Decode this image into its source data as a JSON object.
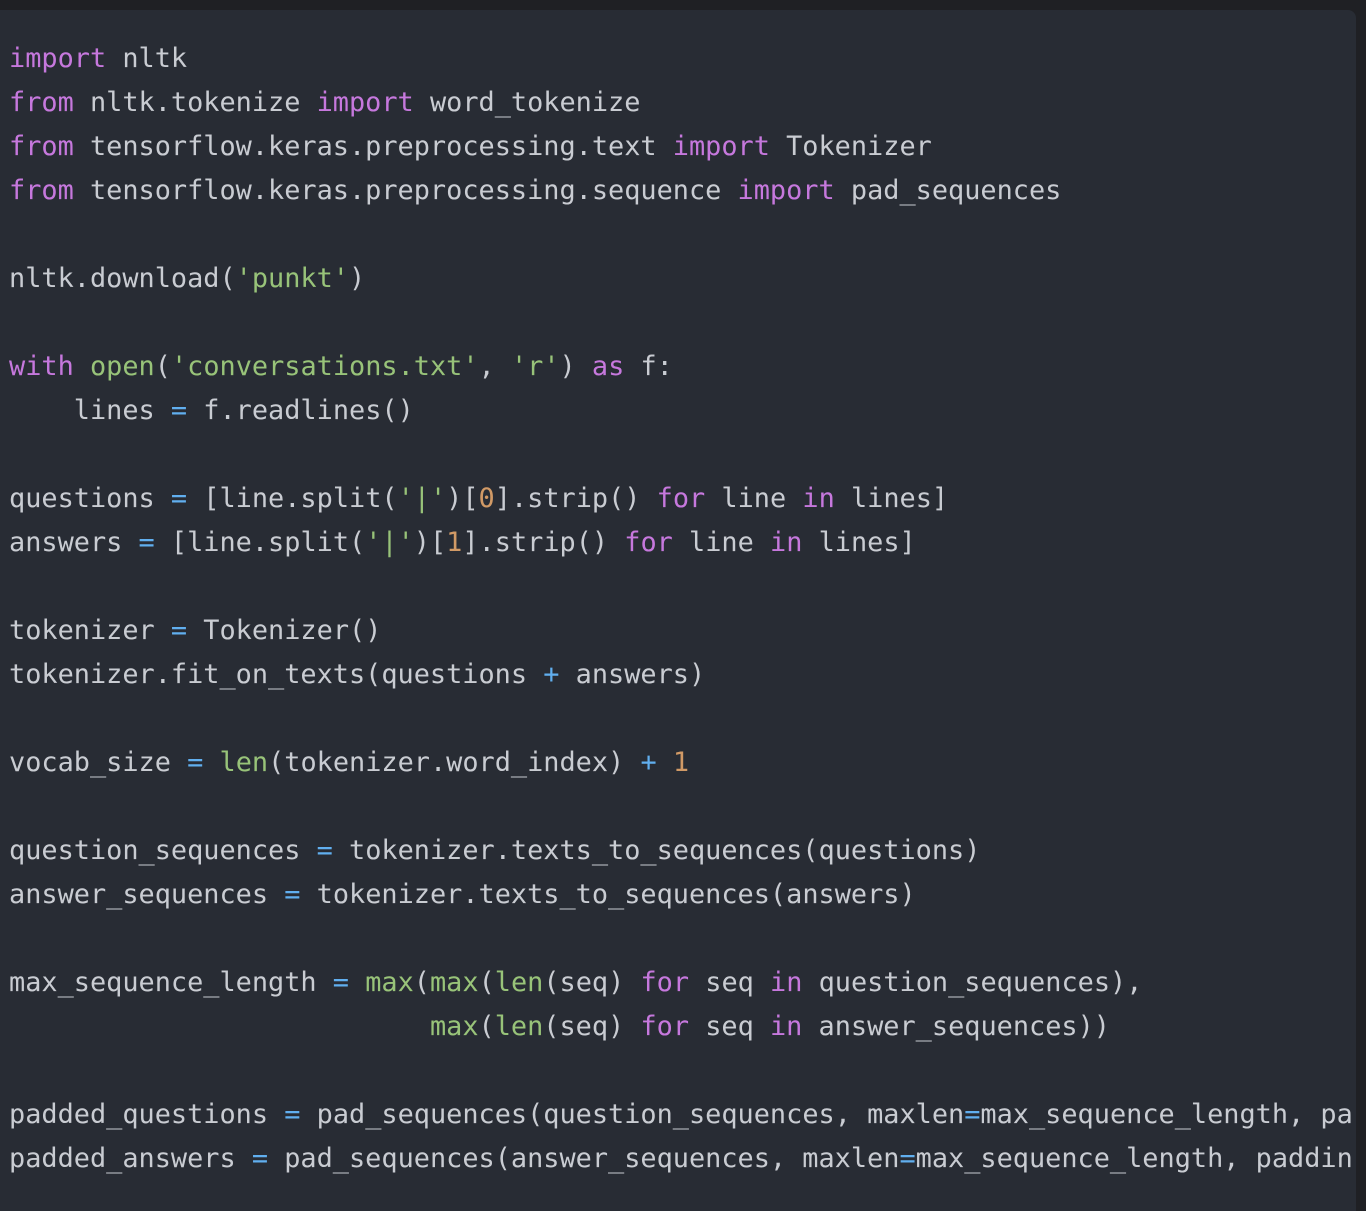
{
  "colors": {
    "background": "#282c34",
    "outer": "#1f2024",
    "plain": "#c9ccd2",
    "keyword": "#c678dd",
    "string": "#98c379",
    "number": "#d19a66",
    "operator": "#61afef",
    "builtin": "#98c379"
  },
  "code": {
    "language": "python",
    "lines": [
      [
        [
          "kw",
          "import"
        ],
        [
          "p",
          " nltk"
        ]
      ],
      [
        [
          "kw",
          "from"
        ],
        [
          "p",
          " nltk.tokenize "
        ],
        [
          "kw",
          "import"
        ],
        [
          "p",
          " word_tokenize"
        ]
      ],
      [
        [
          "kw",
          "from"
        ],
        [
          "p",
          " tensorflow.keras.preprocessing.text "
        ],
        [
          "kw",
          "import"
        ],
        [
          "p",
          " Tokenizer"
        ]
      ],
      [
        [
          "kw",
          "from"
        ],
        [
          "p",
          " tensorflow.keras.preprocessing.sequence "
        ],
        [
          "kw",
          "import"
        ],
        [
          "p",
          " pad_sequences"
        ]
      ],
      [],
      [
        [
          "p",
          "nltk.download("
        ],
        [
          "str",
          "'punkt'"
        ],
        [
          "p",
          ")"
        ]
      ],
      [],
      [
        [
          "kw",
          "with"
        ],
        [
          "p",
          " "
        ],
        [
          "bi",
          "open"
        ],
        [
          "p",
          "("
        ],
        [
          "str",
          "'conversations.txt'"
        ],
        [
          "p",
          ", "
        ],
        [
          "str",
          "'r'"
        ],
        [
          "p",
          ") "
        ],
        [
          "kw",
          "as"
        ],
        [
          "p",
          " f:"
        ]
      ],
      [
        [
          "p",
          "    lines "
        ],
        [
          "op",
          "="
        ],
        [
          "p",
          " f.readlines()"
        ]
      ],
      [],
      [
        [
          "p",
          "questions "
        ],
        [
          "op",
          "="
        ],
        [
          "p",
          " [line.split("
        ],
        [
          "str",
          "'|'"
        ],
        [
          "p",
          ")["
        ],
        [
          "num",
          "0"
        ],
        [
          "p",
          "].strip() "
        ],
        [
          "kw",
          "for"
        ],
        [
          "p",
          " line "
        ],
        [
          "kw",
          "in"
        ],
        [
          "p",
          " lines]"
        ]
      ],
      [
        [
          "p",
          "answers "
        ],
        [
          "op",
          "="
        ],
        [
          "p",
          " [line.split("
        ],
        [
          "str",
          "'|'"
        ],
        [
          "p",
          ")["
        ],
        [
          "num",
          "1"
        ],
        [
          "p",
          "].strip() "
        ],
        [
          "kw",
          "for"
        ],
        [
          "p",
          " line "
        ],
        [
          "kw",
          "in"
        ],
        [
          "p",
          " lines]"
        ]
      ],
      [],
      [
        [
          "p",
          "tokenizer "
        ],
        [
          "op",
          "="
        ],
        [
          "p",
          " Tokenizer()"
        ]
      ],
      [
        [
          "p",
          "tokenizer.fit_on_texts(questions "
        ],
        [
          "op",
          "+"
        ],
        [
          "p",
          " answers)"
        ]
      ],
      [],
      [
        [
          "p",
          "vocab_size "
        ],
        [
          "op",
          "="
        ],
        [
          "p",
          " "
        ],
        [
          "bi",
          "len"
        ],
        [
          "p",
          "(tokenizer.word_index) "
        ],
        [
          "op",
          "+"
        ],
        [
          "p",
          " "
        ],
        [
          "num",
          "1"
        ]
      ],
      [],
      [
        [
          "p",
          "question_sequences "
        ],
        [
          "op",
          "="
        ],
        [
          "p",
          " tokenizer.texts_to_sequences(questions)"
        ]
      ],
      [
        [
          "p",
          "answer_sequences "
        ],
        [
          "op",
          "="
        ],
        [
          "p",
          " tokenizer.texts_to_sequences(answers)"
        ]
      ],
      [],
      [
        [
          "p",
          "max_sequence_length "
        ],
        [
          "op",
          "="
        ],
        [
          "p",
          " "
        ],
        [
          "bi",
          "max"
        ],
        [
          "p",
          "("
        ],
        [
          "bi",
          "max"
        ],
        [
          "p",
          "("
        ],
        [
          "bi",
          "len"
        ],
        [
          "p",
          "(seq) "
        ],
        [
          "kw",
          "for"
        ],
        [
          "p",
          " seq "
        ],
        [
          "kw",
          "in"
        ],
        [
          "p",
          " question_sequences),"
        ]
      ],
      [
        [
          "p",
          "                          "
        ],
        [
          "bi",
          "max"
        ],
        [
          "p",
          "("
        ],
        [
          "bi",
          "len"
        ],
        [
          "p",
          "(seq) "
        ],
        [
          "kw",
          "for"
        ],
        [
          "p",
          " seq "
        ],
        [
          "kw",
          "in"
        ],
        [
          "p",
          " answer_sequences))"
        ]
      ],
      [],
      [
        [
          "p",
          "padded_questions "
        ],
        [
          "op",
          "="
        ],
        [
          "p",
          " pad_sequences(question_sequences, maxlen"
        ],
        [
          "op",
          "="
        ],
        [
          "p",
          "max_sequence_length, pa"
        ]
      ],
      [
        [
          "p",
          "padded_answers "
        ],
        [
          "op",
          "="
        ],
        [
          "p",
          " pad_sequences(answer_sequences, maxlen"
        ],
        [
          "op",
          "="
        ],
        [
          "p",
          "max_sequence_length, paddin"
        ]
      ]
    ]
  }
}
